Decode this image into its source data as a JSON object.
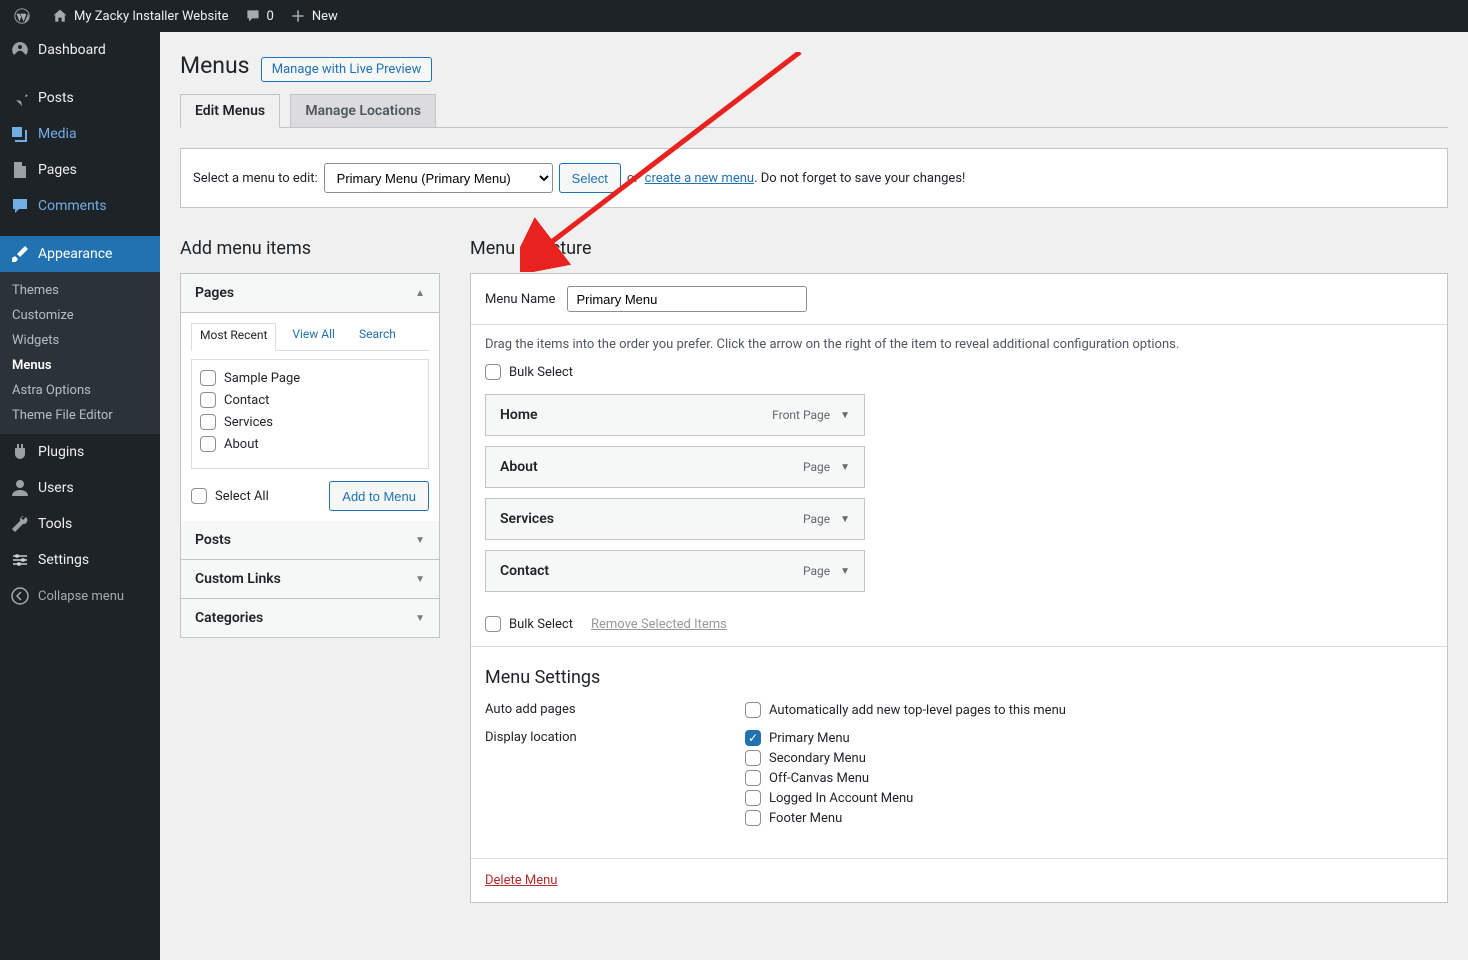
{
  "adminbar": {
    "site_title": "My Zacky Installer Website",
    "comments": "0",
    "new_label": "New"
  },
  "sidebar": {
    "items": [
      {
        "id": "dashboard",
        "label": "Dashboard"
      },
      {
        "id": "posts",
        "label": "Posts"
      },
      {
        "id": "media",
        "label": "Media"
      },
      {
        "id": "pages",
        "label": "Pages"
      },
      {
        "id": "comments",
        "label": "Comments"
      },
      {
        "id": "appearance",
        "label": "Appearance"
      },
      {
        "id": "plugins",
        "label": "Plugins"
      },
      {
        "id": "users",
        "label": "Users"
      },
      {
        "id": "tools",
        "label": "Tools"
      },
      {
        "id": "settings",
        "label": "Settings"
      }
    ],
    "appearance_sub": [
      {
        "label": "Themes"
      },
      {
        "label": "Customize"
      },
      {
        "label": "Widgets"
      },
      {
        "label": "Menus"
      },
      {
        "label": "Astra Options"
      },
      {
        "label": "Theme File Editor"
      }
    ],
    "collapse_label": "Collapse menu"
  },
  "page": {
    "title": "Menus",
    "action_button": "Manage with Live Preview"
  },
  "tabs": [
    "Edit Menus",
    "Manage Locations"
  ],
  "select_row": {
    "label": "Select a menu to edit:",
    "selected": "Primary Menu (Primary Menu)",
    "button": "Select",
    "or": "or",
    "create_link": "create a new menu",
    "trailing": ". Do not forget to save your changes!"
  },
  "left": {
    "heading": "Add menu items",
    "acc_pages": "Pages",
    "inner_tabs": [
      "Most Recent",
      "View All",
      "Search"
    ],
    "pages": [
      "Sample Page",
      "Contact",
      "Services",
      "About"
    ],
    "select_all": "Select All",
    "add_button": "Add to Menu",
    "acc_posts": "Posts",
    "acc_links": "Custom Links",
    "acc_cats": "Categories"
  },
  "right": {
    "heading": "Menu structure",
    "name_label": "Menu Name",
    "name_value": "Primary Menu",
    "instructions": "Drag the items into the order you prefer. Click the arrow on the right of the item to reveal additional configuration options.",
    "bulk_select": "Bulk Select",
    "remove_selected": "Remove Selected Items",
    "items": [
      {
        "title": "Home",
        "type": "Front Page"
      },
      {
        "title": "About",
        "type": "Page"
      },
      {
        "title": "Services",
        "type": "Page"
      },
      {
        "title": "Contact",
        "type": "Page"
      }
    ],
    "settings_heading": "Menu Settings",
    "auto_add_label": "Auto add pages",
    "auto_add_option": "Automatically add new top-level pages to this menu",
    "display_loc_label": "Display location",
    "locations": [
      {
        "label": "Primary Menu",
        "checked": true
      },
      {
        "label": "Secondary Menu",
        "checked": false
      },
      {
        "label": "Off-Canvas Menu",
        "checked": false
      },
      {
        "label": "Logged In Account Menu",
        "checked": false
      },
      {
        "label": "Footer Menu",
        "checked": false
      }
    ],
    "delete_label": "Delete Menu"
  }
}
